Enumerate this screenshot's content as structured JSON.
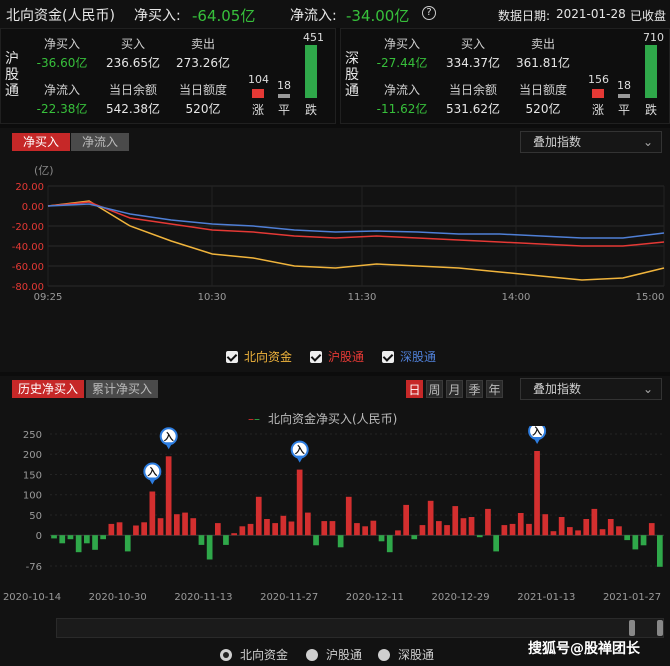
{
  "header": {
    "title": "北向资金(人民币)",
    "net_buy_label": "净买入:",
    "net_buy_value": "-64.05亿",
    "net_inflow_label": "净流入:",
    "net_inflow_value": "-34.00亿",
    "data_date_label": "数据日期:",
    "data_date_value": "2021-01-28",
    "status": "已收盘"
  },
  "sh": {
    "name": "沪股通",
    "net_buy_label": "净买入",
    "net_buy": "-36.60亿",
    "buy_label": "买入",
    "buy": "236.65亿",
    "sell_label": "卖出",
    "sell": "273.26亿",
    "net_inflow_label": "净流入",
    "net_inflow": "-22.38亿",
    "balance_label": "当日余额",
    "balance": "542.38亿",
    "quota_label": "当日额度",
    "quota": "520亿",
    "up": "104",
    "flat": "18",
    "down": "451",
    "up_label": "涨",
    "flat_label": "平",
    "down_label": "跌"
  },
  "sz": {
    "name": "深股通",
    "net_buy_label": "净买入",
    "net_buy": "-27.44亿",
    "buy_label": "买入",
    "buy": "334.37亿",
    "sell_label": "卖出",
    "sell": "361.81亿",
    "net_inflow_label": "净流入",
    "net_inflow": "-11.62亿",
    "balance_label": "当日余额",
    "balance": "531.62亿",
    "quota_label": "当日额度",
    "quota": "520亿",
    "up": "156",
    "flat": "18",
    "down": "710",
    "up_label": "涨",
    "flat_label": "平",
    "down_label": "跌"
  },
  "intraday": {
    "tab_net_buy": "净买入",
    "tab_net_inflow": "净流入",
    "overlay": "叠加指数",
    "unit": "(亿)",
    "legend": [
      "北向资金",
      "沪股通",
      "深股通"
    ]
  },
  "history": {
    "tab_hist": "历史净买入",
    "tab_cum": "累计净买入",
    "periods": [
      "日",
      "周",
      "月",
      "季",
      "年"
    ],
    "overlay": "叠加指数",
    "legend_title": "北向资金净买入(人民币)",
    "marker": "入",
    "radios": [
      "北向资金",
      "沪股通",
      "深股通"
    ]
  },
  "watermark": "搜狐号@股禅团长",
  "colors": {
    "north": "#f0b43c",
    "sh": "#e53935",
    "sz": "#4f7fd6",
    "up": "#d32f2f",
    "down": "#2fa84a"
  },
  "chart_data": [
    {
      "type": "line",
      "unit": "(亿)",
      "ylim": [
        -80,
        20
      ],
      "yticks": [
        20,
        0,
        -20,
        -40,
        -60,
        -80
      ],
      "x": [
        "09:25",
        "10:30",
        "11:30",
        "14:00",
        "15:00"
      ],
      "series": [
        {
          "name": "北向资金",
          "values": [
            0,
            5,
            -20,
            -35,
            -48,
            -52,
            -60,
            -62,
            -58,
            -60,
            -62,
            -66,
            -70,
            -74,
            -72,
            -62
          ]
        },
        {
          "name": "沪股通",
          "values": [
            0,
            4,
            -12,
            -18,
            -24,
            -26,
            -30,
            -32,
            -30,
            -32,
            -34,
            -36,
            -38,
            -40,
            -40,
            -36
          ]
        },
        {
          "name": "深股通",
          "values": [
            0,
            2,
            -8,
            -14,
            -18,
            -20,
            -24,
            -26,
            -25,
            -26,
            -28,
            -28,
            -30,
            -32,
            -32,
            -27
          ]
        }
      ]
    },
    {
      "type": "bar",
      "ylim": [
        -76,
        250
      ],
      "yticks": [
        250,
        200,
        150,
        100,
        50,
        0,
        -76
      ],
      "x": [
        "2020-10-14",
        "2020-10-30",
        "2020-11-13",
        "2020-11-27",
        "2020-12-11",
        "2020-12-29",
        "2021-01-13",
        "2021-01-27"
      ],
      "values": [
        -8,
        -20,
        -10,
        -42,
        -20,
        -36,
        -10,
        28,
        32,
        -40,
        24,
        32,
        108,
        42,
        195,
        52,
        56,
        42,
        -24,
        -60,
        30,
        -24,
        5,
        22,
        28,
        95,
        40,
        30,
        48,
        34,
        162,
        56,
        -25,
        35,
        35,
        -30,
        95,
        30,
        22,
        36,
        -15,
        -42,
        12,
        75,
        -10,
        25,
        85,
        35,
        25,
        72,
        42,
        45,
        -5,
        65,
        -40,
        25,
        28,
        55,
        28,
        208,
        52,
        10,
        45,
        20,
        12,
        40,
        65,
        15,
        40,
        22,
        -12,
        -35,
        -25,
        30,
        -78
      ]
    }
  ]
}
